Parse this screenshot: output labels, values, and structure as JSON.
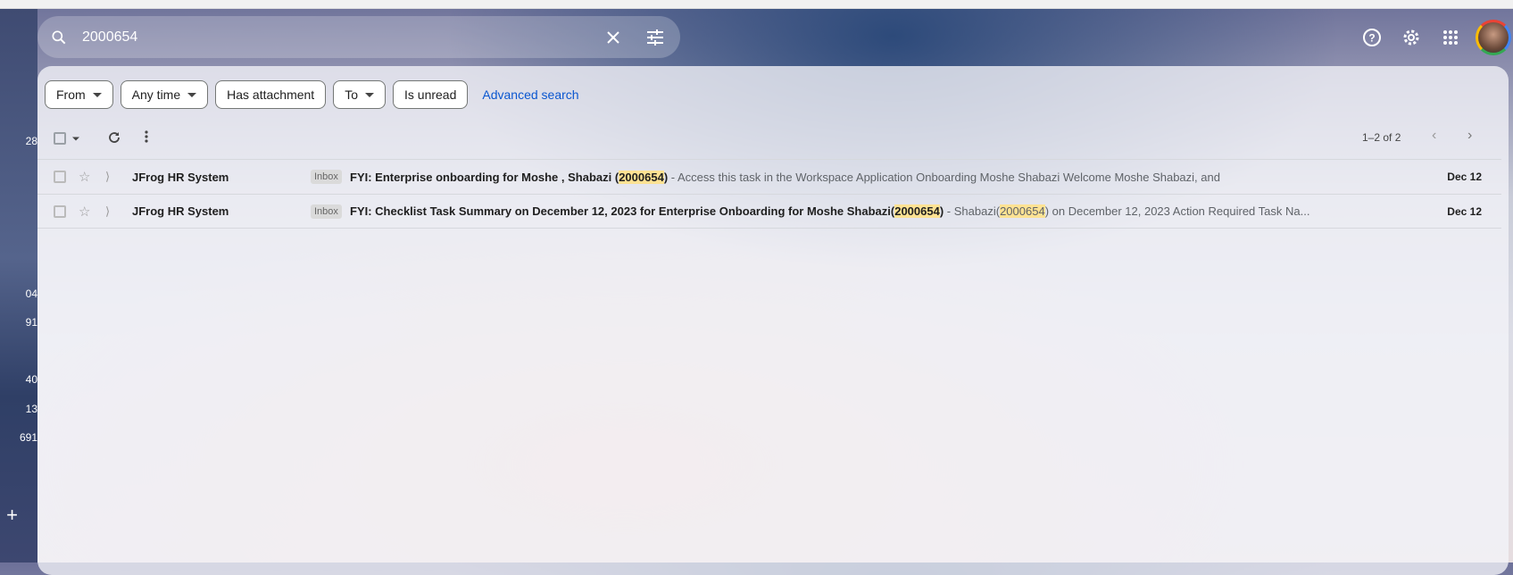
{
  "search": {
    "query": "2000654"
  },
  "sidebar_counts": [
    "28",
    "04",
    "91",
    "40",
    "13",
    "691"
  ],
  "sidebar_add": "+",
  "filters": {
    "chips": [
      {
        "label": "From",
        "dropdown": true
      },
      {
        "label": "Any time",
        "dropdown": true
      },
      {
        "label": "Has attachment",
        "dropdown": false
      },
      {
        "label": "To",
        "dropdown": true
      },
      {
        "label": "Is unread",
        "dropdown": false
      }
    ],
    "advanced": "Advanced search"
  },
  "pagination": {
    "range": "1–2 of 2"
  },
  "emails": [
    {
      "sender": "JFrog HR System",
      "label": "Inbox",
      "subject_pre": "FYI: Enterprise onboarding for Moshe , Shabazi (",
      "subject_hl": "2000654",
      "subject_post": ")",
      "snippet_pre": " - Access this task in the Workspace Application Onboarding Moshe Shabazi Welcome Moshe Shabazi, and",
      "snippet_hl": "",
      "snippet_post": "",
      "date": "Dec 12"
    },
    {
      "sender": "JFrog HR System",
      "label": "Inbox",
      "subject_pre": "FYI: Checklist Task Summary on December 12, 2023 for Enterprise Onboarding for Moshe Shabazi(",
      "subject_hl": "2000654",
      "subject_post": ")",
      "snippet_pre": " - Shabazi(",
      "snippet_hl": "2000654",
      "snippet_post": ") on December 12, 2023 Action Required Task Na...",
      "date": "Dec 12"
    }
  ],
  "colors": {
    "accent": "#0b57d0",
    "highlight": "#fde293"
  }
}
